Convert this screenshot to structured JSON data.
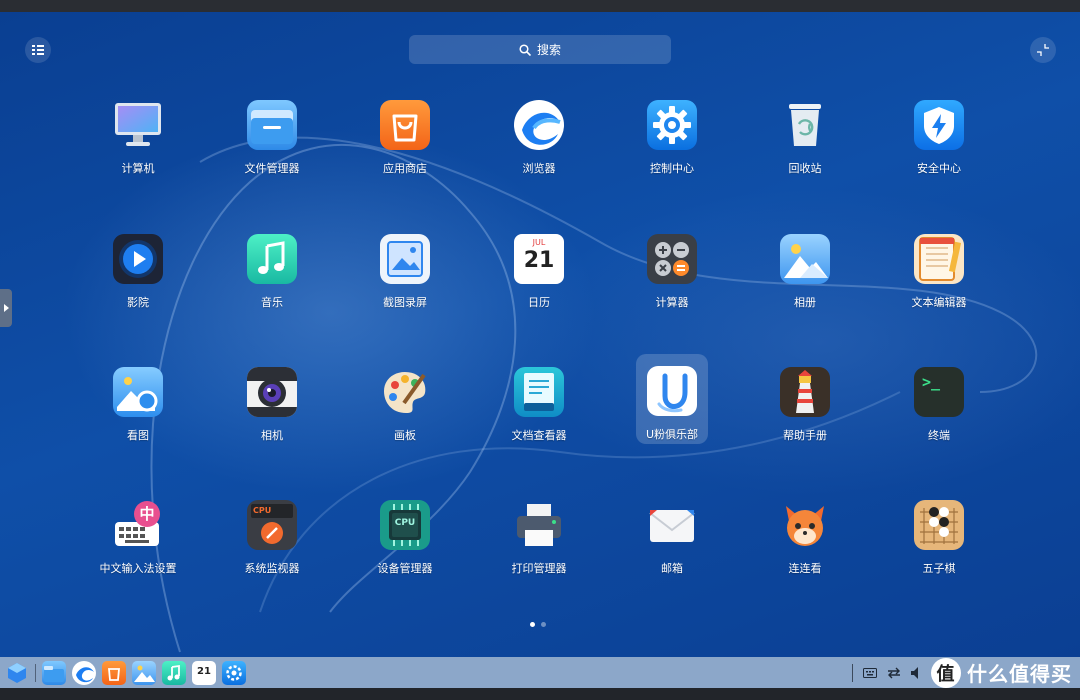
{
  "search": {
    "label": "搜索"
  },
  "launcher": {
    "apps": [
      {
        "label": "计算机",
        "icon": "computer-icon"
      },
      {
        "label": "文件管理器",
        "icon": "folder-icon"
      },
      {
        "label": "应用商店",
        "icon": "app-store-icon"
      },
      {
        "label": "浏览器",
        "icon": "browser-icon"
      },
      {
        "label": "控制中心",
        "icon": "gear-icon"
      },
      {
        "label": "回收站",
        "icon": "trash-icon"
      },
      {
        "label": "安全中心",
        "icon": "shield-icon"
      },
      {
        "label": "影院",
        "icon": "play-icon"
      },
      {
        "label": "音乐",
        "icon": "music-icon"
      },
      {
        "label": "截图录屏",
        "icon": "screenshot-icon"
      },
      {
        "label": "日历",
        "icon": "calendar-icon",
        "month": "JUL",
        "day": "21"
      },
      {
        "label": "计算器",
        "icon": "calculator-icon"
      },
      {
        "label": "相册",
        "icon": "photos-icon"
      },
      {
        "label": "文本编辑器",
        "icon": "notepad-icon"
      },
      {
        "label": "看图",
        "icon": "image-viewer-icon"
      },
      {
        "label": "相机",
        "icon": "camera-icon"
      },
      {
        "label": "画板",
        "icon": "palette-icon"
      },
      {
        "label": "文档查看器",
        "icon": "book-icon"
      },
      {
        "label": "U粉俱乐部",
        "icon": "u-club-icon",
        "selected": true,
        "letter": "U"
      },
      {
        "label": "帮助手册",
        "icon": "lighthouse-icon"
      },
      {
        "label": "终端",
        "icon": "terminal-icon",
        "prompt": ">_"
      },
      {
        "label": "中文输入法设置",
        "icon": "keyboard-icon",
        "badge": "中"
      },
      {
        "label": "系统监视器",
        "icon": "monitor-icon",
        "badge": "CPU"
      },
      {
        "label": "设备管理器",
        "icon": "chip-icon",
        "badge": "CPU"
      },
      {
        "label": "打印管理器",
        "icon": "printer-icon"
      },
      {
        "label": "邮箱",
        "icon": "mail-icon"
      },
      {
        "label": "连连看",
        "icon": "fox-icon"
      },
      {
        "label": "五子棋",
        "icon": "gomoku-icon"
      }
    ]
  },
  "pagination": {
    "pages": 2,
    "current": 1
  },
  "taskbar": {
    "items": [
      "launcher-icon",
      "folder-icon",
      "browser-icon",
      "app-store-icon",
      "photos-icon",
      "music-icon",
      "calendar-icon",
      "gear-icon"
    ],
    "calendar_day": "21"
  },
  "watermark": {
    "logo": "值",
    "text": "什么值得买"
  }
}
